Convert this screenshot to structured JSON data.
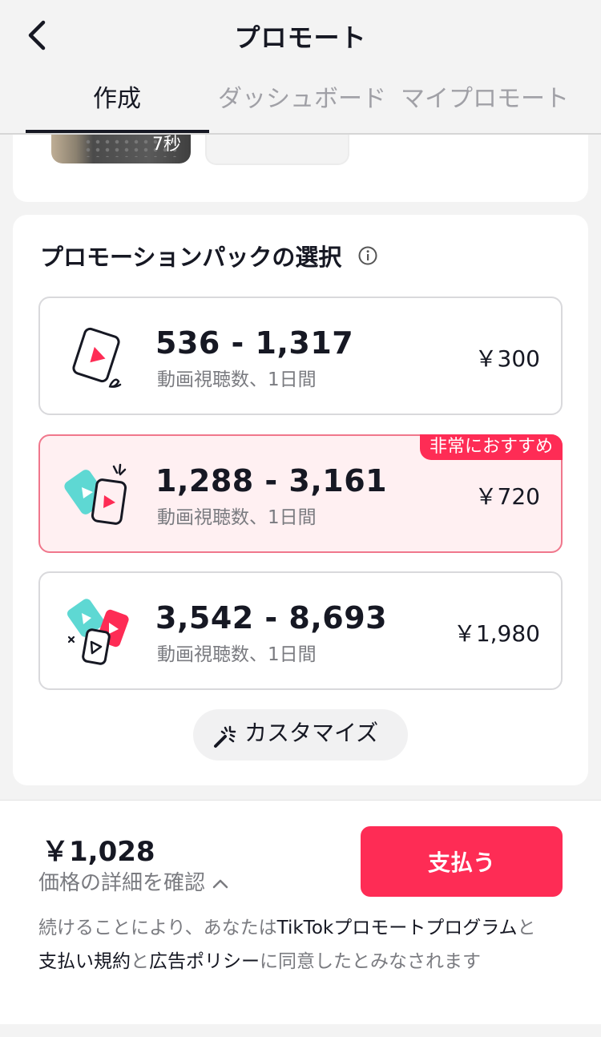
{
  "header": {
    "title": "プロモート",
    "back_icon": "chevron-left-icon"
  },
  "tabs": [
    {
      "label": "作成",
      "active": true
    },
    {
      "label": "ダッシュボード",
      "active": false
    },
    {
      "label": "マイプロモート",
      "active": false
    }
  ],
  "video": {
    "duration": "7秒"
  },
  "packs_section": {
    "title": "プロモーションパックの選択",
    "info_icon": "info-icon",
    "packs": [
      {
        "range": "536 - 1,317",
        "subtitle": "動画視聴数、1日間",
        "price": "￥300",
        "selected": false,
        "badge": ""
      },
      {
        "range": "1,288 - 3,161",
        "subtitle": "動画視聴数、1日間",
        "price": "￥720",
        "selected": true,
        "badge": "非常におすすめ"
      },
      {
        "range": "3,542 - 8,693",
        "subtitle": "動画視聴数、1日間",
        "price": "￥1,980",
        "selected": false,
        "badge": ""
      }
    ],
    "customize_label": "カスタマイズ",
    "customize_icon": "magic-wand-icon"
  },
  "footer": {
    "total": "￥1,028",
    "details_link": "価格の詳細を確認",
    "pay_button": "支払う",
    "terms": {
      "part1": "続けることにより、あなたは",
      "link1": "TikTokプロモートプログラム",
      "part2": "と",
      "link2": "支払い規約",
      "part3": "と",
      "link3": "広告ポリシー",
      "part4": "に同意したとみなされます"
    }
  },
  "colors": {
    "accent": "#fe2c55",
    "teal": "#5ed8d3",
    "selected_bg": "#fff0f2"
  }
}
